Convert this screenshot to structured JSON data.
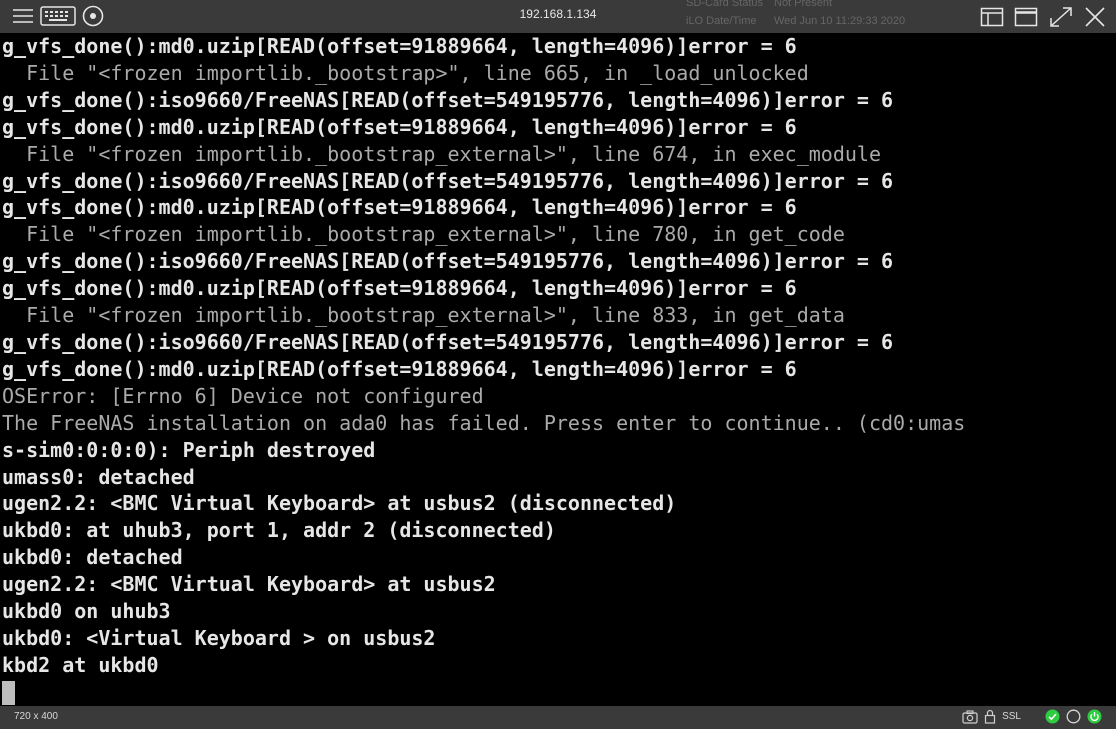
{
  "window": {
    "title": "192.168.1.134"
  },
  "ghost_info": {
    "rows": [
      {
        "label": "SD-Card Status",
        "value": "Not Present"
      },
      {
        "label": "iLO Date/Time",
        "value": "Wed Jun 10 11:29:33 2020"
      }
    ]
  },
  "toolbar_left": {
    "icons": [
      "menu-icon",
      "keyboard-icon",
      "disc-icon"
    ]
  },
  "toolbar_right": {
    "icons": [
      "layout-icon",
      "window-icon",
      "fullscreen-icon",
      "close-icon"
    ]
  },
  "console": {
    "lines": [
      {
        "text": "g_vfs_done():md0.uzip[READ(offset=91889664, length=4096)]error = 6",
        "dim": false
      },
      {
        "text": "  File \"<frozen importlib._bootstrap>\", line 665, in _load_unlocked",
        "dim": true
      },
      {
        "text": "g_vfs_done():iso9660/FreeNAS[READ(offset=549195776, length=4096)]error = 6",
        "dim": false
      },
      {
        "text": "g_vfs_done():md0.uzip[READ(offset=91889664, length=4096)]error = 6",
        "dim": false
      },
      {
        "text": "  File \"<frozen importlib._bootstrap_external>\", line 674, in exec_module",
        "dim": true
      },
      {
        "text": "g_vfs_done():iso9660/FreeNAS[READ(offset=549195776, length=4096)]error = 6",
        "dim": false
      },
      {
        "text": "g_vfs_done():md0.uzip[READ(offset=91889664, length=4096)]error = 6",
        "dim": false
      },
      {
        "text": "  File \"<frozen importlib._bootstrap_external>\", line 780, in get_code",
        "dim": true
      },
      {
        "text": "g_vfs_done():iso9660/FreeNAS[READ(offset=549195776, length=4096)]error = 6",
        "dim": false
      },
      {
        "text": "g_vfs_done():md0.uzip[READ(offset=91889664, length=4096)]error = 6",
        "dim": false
      },
      {
        "text": "  File \"<frozen importlib._bootstrap_external>\", line 833, in get_data",
        "dim": true
      },
      {
        "text": "g_vfs_done():iso9660/FreeNAS[READ(offset=549195776, length=4096)]error = 6",
        "dim": false
      },
      {
        "text": "g_vfs_done():md0.uzip[READ(offset=91889664, length=4096)]error = 6",
        "dim": false
      },
      {
        "text": "OSError: [Errno 6] Device not configured",
        "dim": true
      },
      {
        "text": "The FreeNAS installation on ada0 has failed. Press enter to continue.. (cd0:umas",
        "dim": true
      },
      {
        "text": "s-sim0:0:0:0): Periph destroyed",
        "dim": false
      },
      {
        "text": "umass0: detached",
        "dim": false
      },
      {
        "text": "ugen2.2: <BMC Virtual Keyboard> at usbus2 (disconnected)",
        "dim": false
      },
      {
        "text": "ukbd0: at uhub3, port 1, addr 2 (disconnected)",
        "dim": false
      },
      {
        "text": "ukbd0: detached",
        "dim": false
      },
      {
        "text": "ugen2.2: <BMC Virtual Keyboard> at usbus2",
        "dim": false
      },
      {
        "text": "ukbd0 on uhub3",
        "dim": false
      },
      {
        "text": "ukbd0: <Virtual Keyboard > on usbus2",
        "dim": false
      },
      {
        "text": "kbd2 at ukbd0",
        "dim": false
      }
    ]
  },
  "statusbar": {
    "resolution": "720 x 400",
    "ssl_label": "SSL",
    "icons": [
      "camera-icon",
      "lock-icon",
      "status-green-check-icon",
      "status-empty-circle-icon",
      "status-green-power-icon"
    ],
    "colors": {
      "green": "#2ecc40"
    }
  }
}
